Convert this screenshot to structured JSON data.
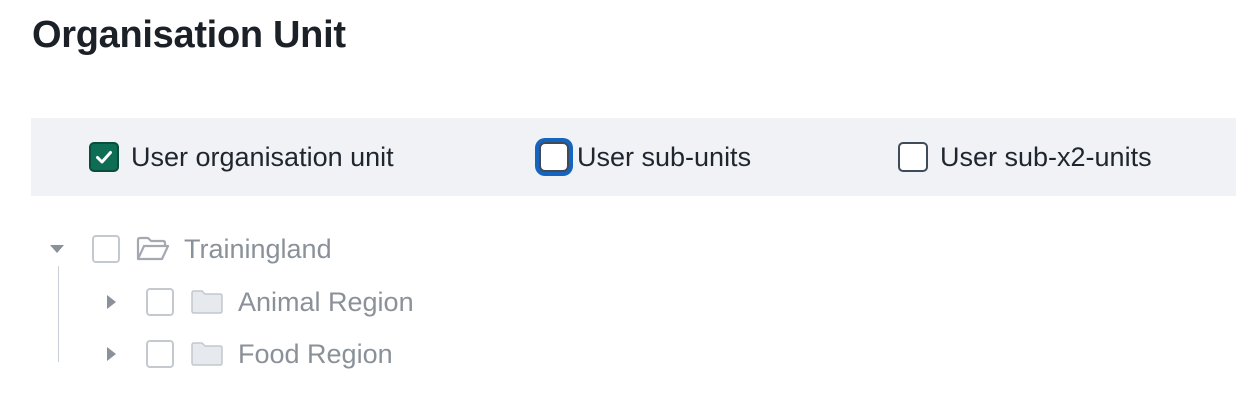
{
  "page": {
    "title": "Organisation Unit"
  },
  "options": [
    {
      "label": "User organisation unit",
      "checked": true,
      "focused": false
    },
    {
      "label": "User sub-units",
      "checked": false,
      "focused": true
    },
    {
      "label": "User sub-x2-units",
      "checked": false,
      "focused": false
    }
  ],
  "tree": {
    "root": {
      "label": "Trainingland",
      "expanded": true,
      "icon": "folder-open-icon"
    },
    "children": [
      {
        "label": "Animal Region",
        "expanded": false,
        "icon": "folder-icon"
      },
      {
        "label": "Food Region",
        "expanded": false,
        "icon": "folder-icon"
      }
    ]
  },
  "colors": {
    "accent_checked": "#0e6e55",
    "focus_ring": "#1565c0",
    "toolbar_bg": "#f0f2f5",
    "tree_text": "#8a9199"
  }
}
